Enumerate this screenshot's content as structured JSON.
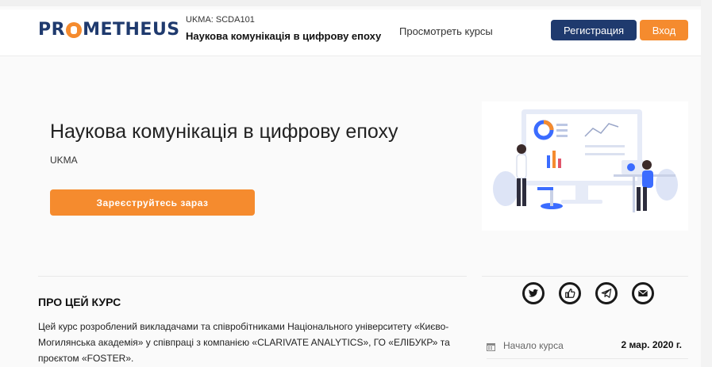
{
  "header": {
    "logo_text": "PROMETHEUS",
    "course_code": "UKMA: SCDA101",
    "course_name": "Наукова комунікація в цифрову епоху",
    "browse_label": "Просмотреть курсы",
    "register_label": "Регистрация",
    "login_label": "Вход"
  },
  "hero": {
    "title": "Наукова комунікація в цифрову епоху",
    "org": "UKMA",
    "cta_label": "Зареєструйтесь зараз"
  },
  "about": {
    "heading": "ПРО ЦЕЙ КУРС",
    "text": "Цей курс розроблений викладачами та співробітниками Національного університету «Києво-Могилянська академія» у співпраці з компанією «CLARIVATE ANALYTICS», ГО «ЕЛІБУКР» та проєктом «FOSTER»."
  },
  "sidebar": {
    "share_icons": [
      "twitter-icon",
      "like-icon",
      "telegram-icon",
      "mail-icon"
    ],
    "start_label": "Начало курса",
    "start_value": "2 мар. 2020 г."
  },
  "colors": {
    "brand_navy": "#1f3a6e",
    "brand_orange": "#f58b2e"
  }
}
